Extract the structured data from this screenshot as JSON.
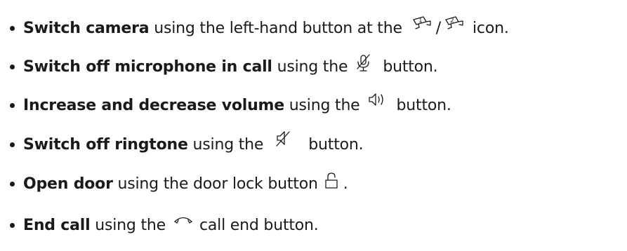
{
  "items": [
    {
      "bold": "Switch camera",
      "before": " using the left-hand button at the",
      "sep": "/",
      "after": "icon.",
      "icons": [
        "camera-1-icon",
        "camera-2-icon"
      ]
    },
    {
      "bold": "Switch off microphone in call",
      "before": " using the",
      "after": "button.",
      "icons": [
        "microphone-muted-icon"
      ]
    },
    {
      "bold": "Increase and decrease volume",
      "before": " using the",
      "after": "button.",
      "icons": [
        "speaker-volume-icon"
      ]
    },
    {
      "bold": "Switch off ringtone",
      "before": " using the",
      "after": "button.",
      "icons": [
        "ringtone-muted-icon"
      ]
    },
    {
      "bold": "Open door",
      "before": " using the door lock button",
      "after": ".",
      "icons": [
        "door-lock-icon"
      ]
    },
    {
      "bold": "End call",
      "before": " using the",
      "after": "call end button.",
      "icons": [
        "end-call-icon"
      ]
    }
  ]
}
